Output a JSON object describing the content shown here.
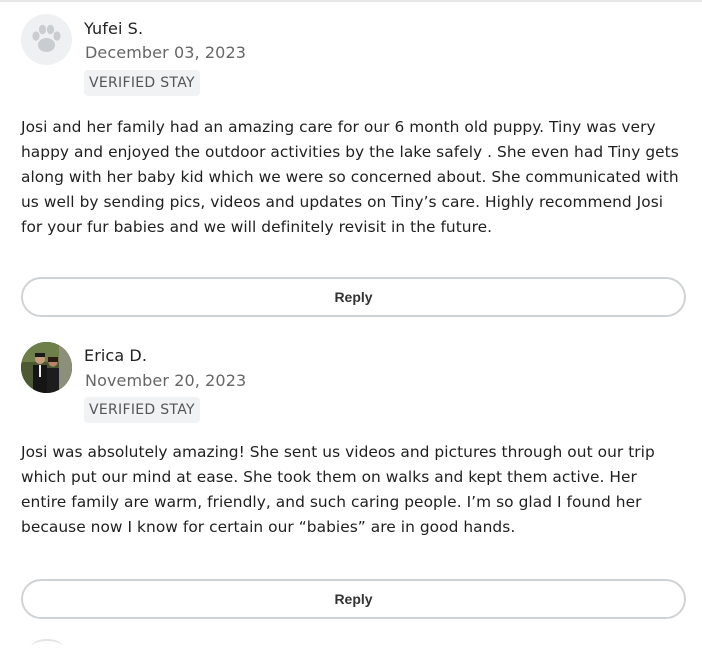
{
  "reviews": [
    {
      "reviewer_name": "Yufei S.",
      "date": "December 03, 2023",
      "badge": "VERIFIED STAY",
      "avatar_icon": "paw-icon",
      "text": "Josi and her family had an amazing care for our 6 month old puppy. Tiny was very happy and enjoyed the outdoor activities by the lake safely . She even had Tiny gets along with her baby kid which we were so concerned about. She communicated with us well by sending pics, videos and updates on Tiny’s care. Highly recommend Josi for your fur babies and we will definitely revisit in the future.",
      "reply_label": "Reply"
    },
    {
      "reviewer_name": "Erica D.",
      "date": "November 20, 2023",
      "badge": "VERIFIED STAY",
      "avatar_icon": "user-photo",
      "text": "Josi was absolutely amazing! She sent us videos and pictures through out our trip which put our mind at ease. She took them on walks and kept them active. Her entire family are warm, friendly, and such caring people. I’m so glad I found her because now I know for certain our “babies” are in good hands.",
      "reply_label": "Reply"
    }
  ],
  "colors": {
    "badge_bg": "#f1f2f3",
    "button_border": "#d0d3d5",
    "date_text": "#666666"
  }
}
